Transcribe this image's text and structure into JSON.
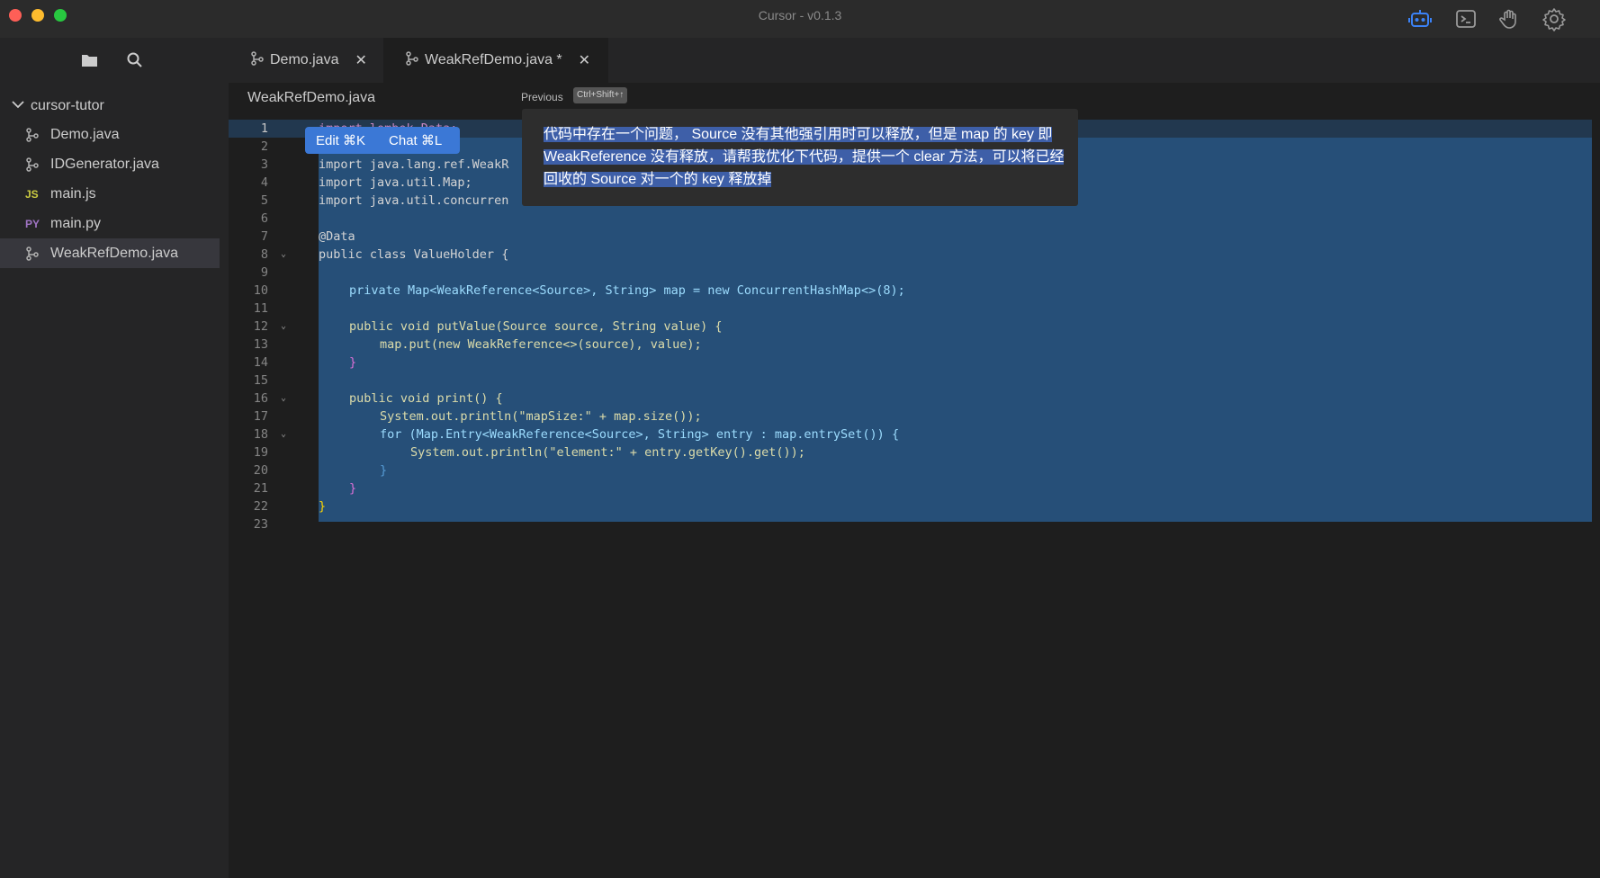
{
  "window": {
    "title": "Cursor - v0.1.3"
  },
  "sidebar": {
    "root": "cursor-tutor",
    "files": [
      {
        "label": "Demo.java",
        "icon": "java-file-icon",
        "badge": ""
      },
      {
        "label": "IDGenerator.java",
        "icon": "java-file-icon",
        "badge": ""
      },
      {
        "label": "main.js",
        "icon": "js-file-icon",
        "badge": "JS"
      },
      {
        "label": "main.py",
        "icon": "python-file-icon",
        "badge": "PY"
      },
      {
        "label": "WeakRefDemo.java",
        "icon": "java-file-icon",
        "badge": ""
      }
    ]
  },
  "tabs": [
    {
      "label": "Demo.java"
    },
    {
      "label": "WeakRefDemo.java *"
    }
  ],
  "breadcrumb": {
    "file": "WeakRefDemo.java"
  },
  "prompt_nav": {
    "previous_label": "Previous",
    "shortcut": "Ctrl+Shift+↑"
  },
  "edit_chat": {
    "edit_label": "Edit ⌘K",
    "chat_label": "Chat ⌘L"
  },
  "prompt": {
    "text": "代码中存在一个问题， Source 没有其他强引用时可以释放，但是 map 的 key 即 WeakReference 没有释放，请帮我优化下代码，提供一个 clear 方法，可以将已经回收的 Source 对一个的 key 释放掉"
  },
  "line_numbers": [
    "1",
    "2",
    "3",
    "4",
    "5",
    "6",
    "7",
    "8",
    "9",
    "10",
    "11",
    "12",
    "13",
    "14",
    "15",
    "16",
    "17",
    "18",
    "19",
    "20",
    "21",
    "22",
    "23"
  ],
  "code_text": {
    "l1": "import lombok.Data;",
    "l3": "import java.lang.ref.WeakR",
    "l4": "import java.util.Map;",
    "l5": "import java.util.concurren",
    "l7": "@Data",
    "l8": "public class ValueHolder {",
    "l10": "private Map<WeakReference<Source>, String> map = new ConcurrentHashMap<>(8);",
    "l12": "public void putValue(Source source, String value) {",
    "l13": "map.put(new WeakReference<>(source), value);",
    "l14": "}",
    "l16": "public void print() {",
    "l17": "System.out.println(\"mapSize:\" + map.size());",
    "l18": "for (Map.Entry<WeakReference<Source>, String> entry : map.entrySet()) {",
    "l19": "System.out.println(\"element:\" + entry.getKey().get());",
    "l20": "}",
    "l21": "}",
    "l22": "}"
  },
  "colors": {
    "selection": "#264f78",
    "accent": "#3b78d6",
    "robot_icon": "#3b82f6"
  }
}
